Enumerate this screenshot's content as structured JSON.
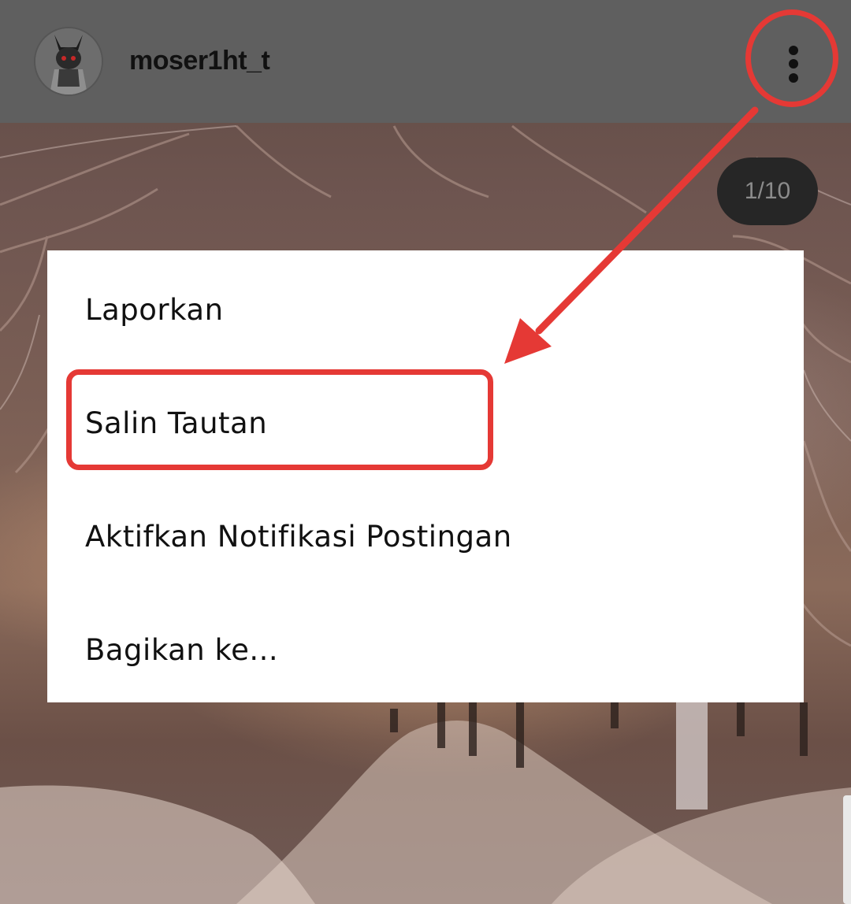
{
  "post": {
    "username": "moser1ht_t",
    "avatar_icon": "dark-character-avatar-icon",
    "more_icon": "more-vertical-icon",
    "image_counter": "1/10"
  },
  "menu": {
    "items": [
      {
        "label": "Laporkan"
      },
      {
        "label": "Salin Tautan"
      },
      {
        "label": "Aktifkan Notifikasi Postingan"
      },
      {
        "label": "Bagikan ke..."
      }
    ]
  },
  "annotation": {
    "color": "#e53935"
  }
}
